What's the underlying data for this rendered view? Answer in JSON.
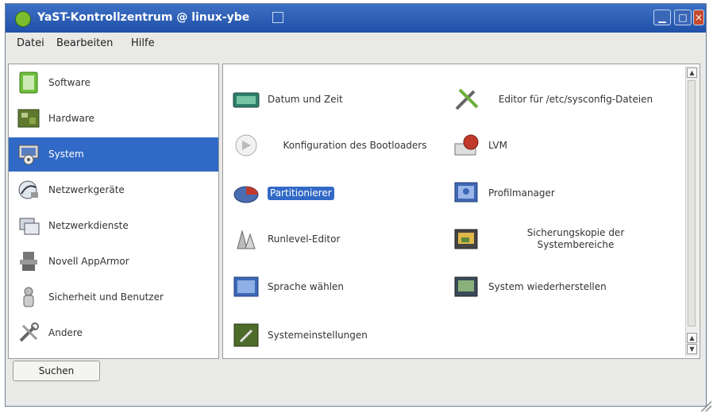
{
  "window": {
    "title": "YaST-Kontrollzentrum @ linux-ybe",
    "controls": [
      "minimize",
      "maximize",
      "close"
    ]
  },
  "menubar": {
    "items": [
      "Datei",
      "Bearbeiten",
      "Hilfe"
    ]
  },
  "sidebar": {
    "selected_index": 2,
    "items": [
      {
        "label": "Software",
        "icon": "software-icon"
      },
      {
        "label": "Hardware",
        "icon": "hardware-icon"
      },
      {
        "label": "System",
        "icon": "system-icon"
      },
      {
        "label": "Netzwerkgeräte",
        "icon": "network-devices-icon"
      },
      {
        "label": "Netzwerkdienste",
        "icon": "network-services-icon"
      },
      {
        "label": "Novell AppArmor",
        "icon": "apparmor-icon"
      },
      {
        "label": "Sicherheit und Benutzer",
        "icon": "security-users-icon"
      },
      {
        "label": "Andere",
        "icon": "misc-icon"
      }
    ]
  },
  "modules": {
    "left": [
      {
        "label": "Datum und Zeit",
        "icon": "clock-icon"
      },
      {
        "label": "Konfiguration des Bootloaders",
        "icon": "bootloader-icon"
      },
      {
        "label": "Partitionierer",
        "icon": "partitioner-icon",
        "highlighted": true
      },
      {
        "label": "Runlevel-Editor",
        "icon": "runlevel-icon"
      },
      {
        "label": "Sprache wählen",
        "icon": "language-icon"
      },
      {
        "label": "Systemeinstellungen",
        "icon": "system-settings-icon"
      }
    ],
    "right": [
      {
        "label": "Editor für /etc/sysconfig-Dateien",
        "icon": "sysconfig-editor-icon"
      },
      {
        "label": "LVM",
        "icon": "lvm-icon"
      },
      {
        "label": "Profilmanager",
        "icon": "profile-manager-icon"
      },
      {
        "label": "Sicherungskopie der Systembereiche",
        "icon": "backup-icon"
      },
      {
        "label": "System wiederherstellen",
        "icon": "restore-icon"
      }
    ]
  },
  "footer": {
    "search_label": "Suchen"
  },
  "colors": {
    "titlebar": "#2f5fb8",
    "selection": "#3169c6",
    "window_bg": "#e9e9e7"
  }
}
